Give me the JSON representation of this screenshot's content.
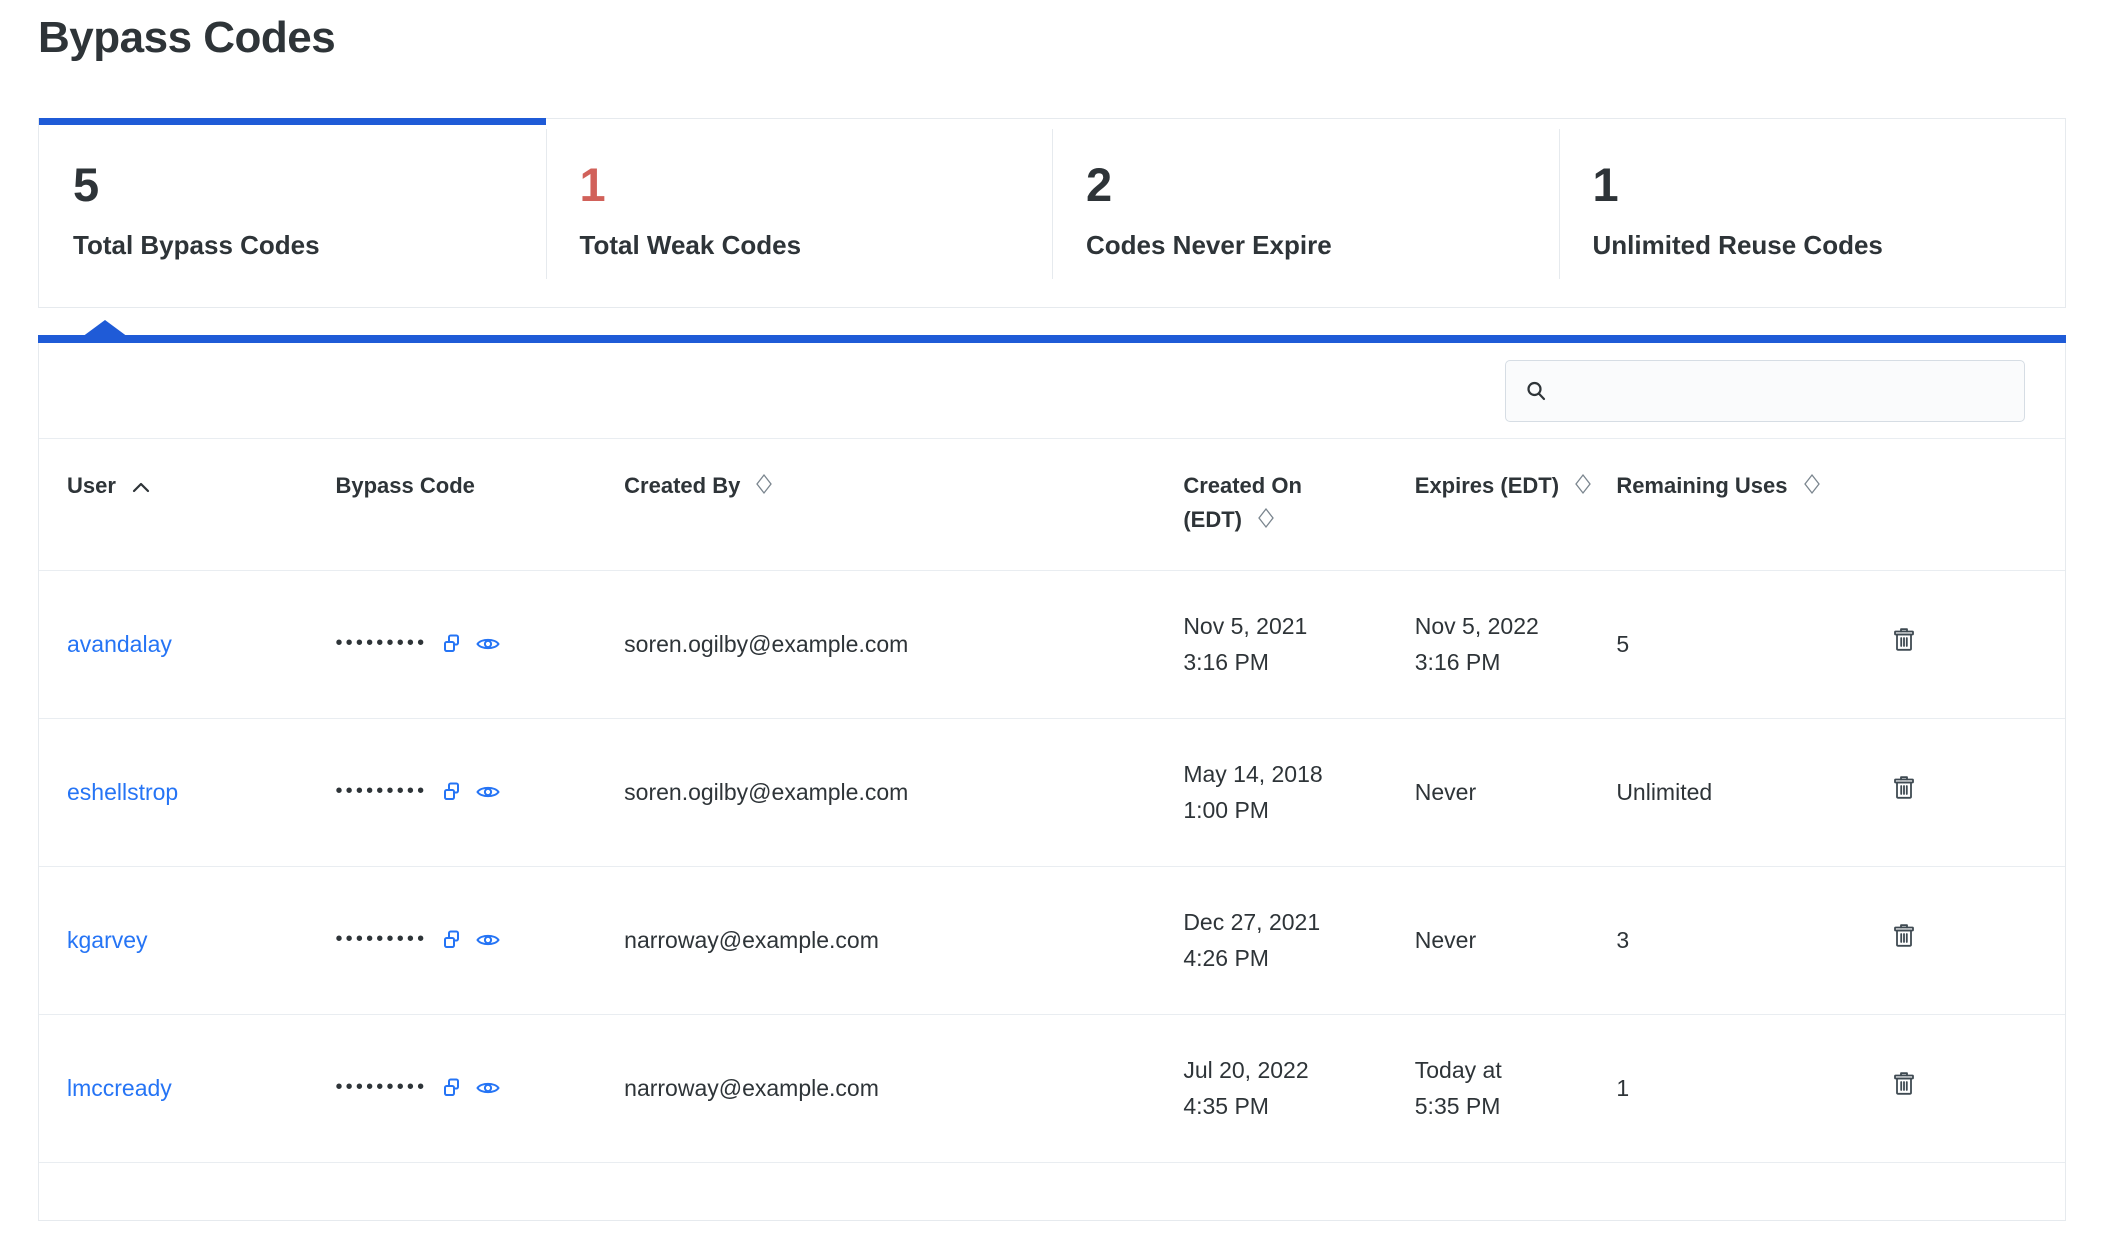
{
  "page": {
    "title": "Bypass Codes"
  },
  "stats": [
    {
      "value": "5",
      "label": "Total Bypass Codes",
      "active": true,
      "tone": "default"
    },
    {
      "value": "1",
      "label": "Total Weak Codes",
      "active": false,
      "tone": "danger"
    },
    {
      "value": "2",
      "label": "Codes Never Expire",
      "active": false,
      "tone": "default"
    },
    {
      "value": "1",
      "label": "Unlimited Reuse Codes",
      "active": false,
      "tone": "default"
    }
  ],
  "search": {
    "value": "",
    "placeholder": "",
    "icon": "search-icon"
  },
  "table": {
    "columns": [
      {
        "label": "User",
        "sort": "asc",
        "icon": "chevron-up-icon"
      },
      {
        "label": "Bypass Code",
        "sort": "none",
        "icon": ""
      },
      {
        "label": "Created By",
        "sort": "sortable",
        "icon": "sort-diamond-icon"
      },
      {
        "label": "Created On (EDT)",
        "line1": "Created On",
        "line2": "(EDT)",
        "sort": "sortable",
        "icon": "sort-diamond-icon"
      },
      {
        "label": "Expires (EDT)",
        "sort": "sortable",
        "icon": "sort-diamond-icon"
      },
      {
        "label": "Remaining Uses",
        "sort": "sortable",
        "icon": "sort-diamond-icon"
      },
      {
        "label": "",
        "sort": "none",
        "icon": ""
      }
    ],
    "masked_code": "•••••••••",
    "row_icons": [
      "copy-icon",
      "eye-icon",
      "trash-icon"
    ],
    "rows": [
      {
        "user": "avandalay",
        "code": "•••••••••",
        "created_by": "soren.ogilby@example.com",
        "created_on_date": "Nov 5, 2021",
        "created_on_time": "3:16 PM",
        "expires_date": "Nov 5, 2022",
        "expires_time": "3:16 PM",
        "remaining_uses": "5"
      },
      {
        "user": "eshellstrop",
        "code": "•••••••••",
        "created_by": "soren.ogilby@example.com",
        "created_on_date": "May 14, 2018",
        "created_on_time": "1:00 PM",
        "expires_date": "Never",
        "expires_time": "",
        "remaining_uses": "Unlimited"
      },
      {
        "user": "kgarvey",
        "code": "•••••••••",
        "created_by": "narroway@example.com",
        "created_on_date": "Dec 27, 2021",
        "created_on_time": "4:26 PM",
        "expires_date": "Never",
        "expires_time": "",
        "remaining_uses": "3"
      },
      {
        "user": "lmccready",
        "code": "•••••••••",
        "created_by": "narroway@example.com",
        "created_on_date": "Jul 20, 2022",
        "created_on_time": "4:35 PM",
        "expires_date": "Today at",
        "expires_time": "5:35 PM",
        "remaining_uses": "1"
      }
    ]
  },
  "colors": {
    "accent": "#1f5bd7",
    "link": "#2574f5",
    "danger": "#d1615a",
    "text": "#2e3438",
    "border": "#e6eaee"
  }
}
